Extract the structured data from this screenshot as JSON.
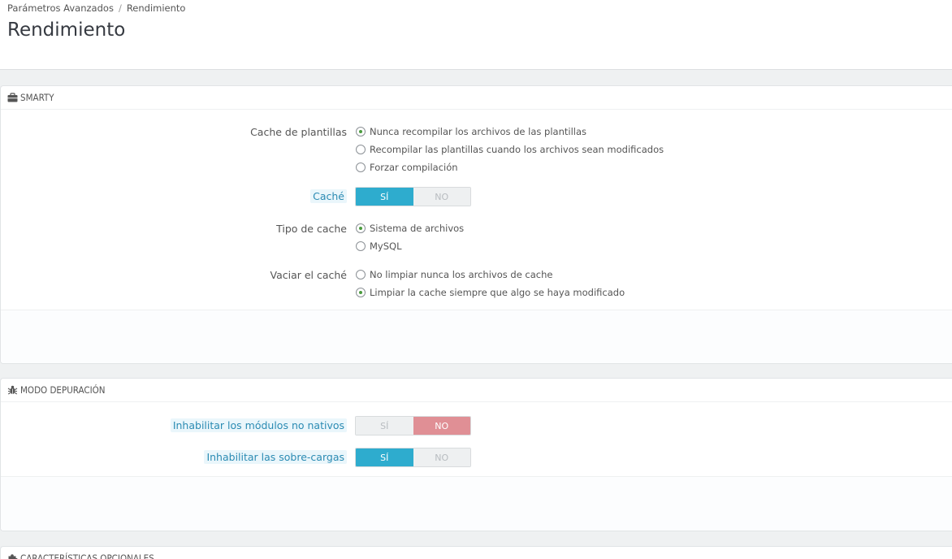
{
  "breadcrumb": {
    "parent": "Parámetros Avanzados",
    "separator": "/",
    "current": "Rendimiento"
  },
  "page_title": "Rendimiento",
  "smarty": {
    "heading": "SMARTY",
    "icon": "briefcase-icon",
    "cache_templates": {
      "label": "Cache de plantillas",
      "options": [
        {
          "label": "Nunca recompilar los archivos de las plantillas",
          "checked": true
        },
        {
          "label": "Recompilar las plantillas cuando los archivos sean modificados",
          "checked": false
        },
        {
          "label": "Forzar compilación",
          "checked": false
        }
      ]
    },
    "cache": {
      "label": "Caché",
      "yes": "SÍ",
      "no": "NO",
      "value": "yes"
    },
    "cache_type": {
      "label": "Tipo de cache",
      "options": [
        {
          "label": "Sistema de archivos",
          "checked": true
        },
        {
          "label": "MySQL",
          "checked": false
        }
      ]
    },
    "clear_cache": {
      "label": "Vaciar el caché",
      "options": [
        {
          "label": "No limpiar nunca los archivos de cache",
          "checked": false
        },
        {
          "label": "Limpiar la cache siempre que algo se haya modificado",
          "checked": true
        }
      ]
    }
  },
  "debug": {
    "heading": "MODO DEPURACIÓN",
    "icon": "bug-icon",
    "disable_non_native": {
      "label": "Inhabilitar los módulos no nativos",
      "yes": "SÍ",
      "no": "NO",
      "value": "no"
    },
    "disable_overrides": {
      "label": "Inhabilitar las sobre-cargas",
      "yes": "SÍ",
      "no": "NO",
      "value": "yes"
    }
  },
  "optional": {
    "heading": "CARACTERÍSTICAS OPCIONALES",
    "icon": "puzzle-icon"
  },
  "colors": {
    "accent": "#2eacce",
    "danger": "#e08f95",
    "radio_checked": "#4a9b3e"
  }
}
